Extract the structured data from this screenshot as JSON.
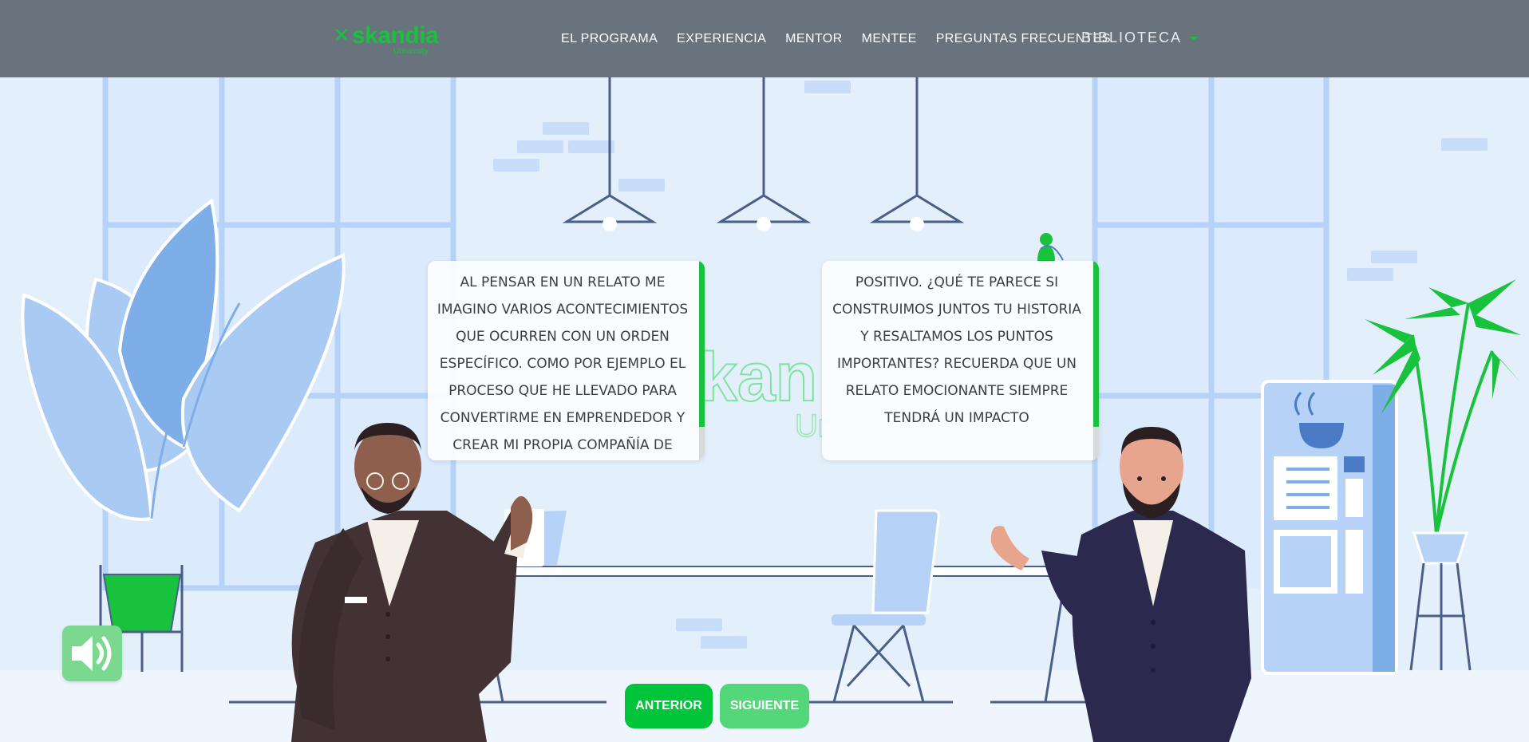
{
  "brand": {
    "name": "skandia",
    "tagline": "University",
    "color": "#19c23c"
  },
  "nav": {
    "items": [
      {
        "label": "EL PROGRAMA"
      },
      {
        "label": "EXPERIENCIA"
      },
      {
        "label": "MENTOR"
      },
      {
        "label": "MENTEE"
      },
      {
        "label": "PREGUNTAS FRECUENTES"
      }
    ],
    "dropdown": {
      "label": "BIBLIOTECA",
      "icon": "caret-down-icon"
    }
  },
  "dialogue": {
    "left": "Al pensar en un relato me imagino varios acontecimientos que ocurren con un orden específico. Como por ejemplo el proceso que he llevado para convertirme en emprendedor y crear mi propia compañía de",
    "right": "positivo. ¿Qué te parece si construimos juntos tu historia y resaltamos los puntos importantes? Recuerda que un relato emocionante siempre tendrá un impacto"
  },
  "background_logo": {
    "text": "kan",
    "sub": "Ur"
  },
  "controls": {
    "prev": "ANTERIOR",
    "next": "SIGUIENTE",
    "sound_icon": "speaker-icon"
  },
  "colors": {
    "navbar": "#646e7a",
    "accent": "#19c23c",
    "button_prev": "#00c43a",
    "button_next": "#54d67a",
    "background": "#e4effc",
    "left_suit": "#433234",
    "right_suit": "#2b2a4e"
  }
}
